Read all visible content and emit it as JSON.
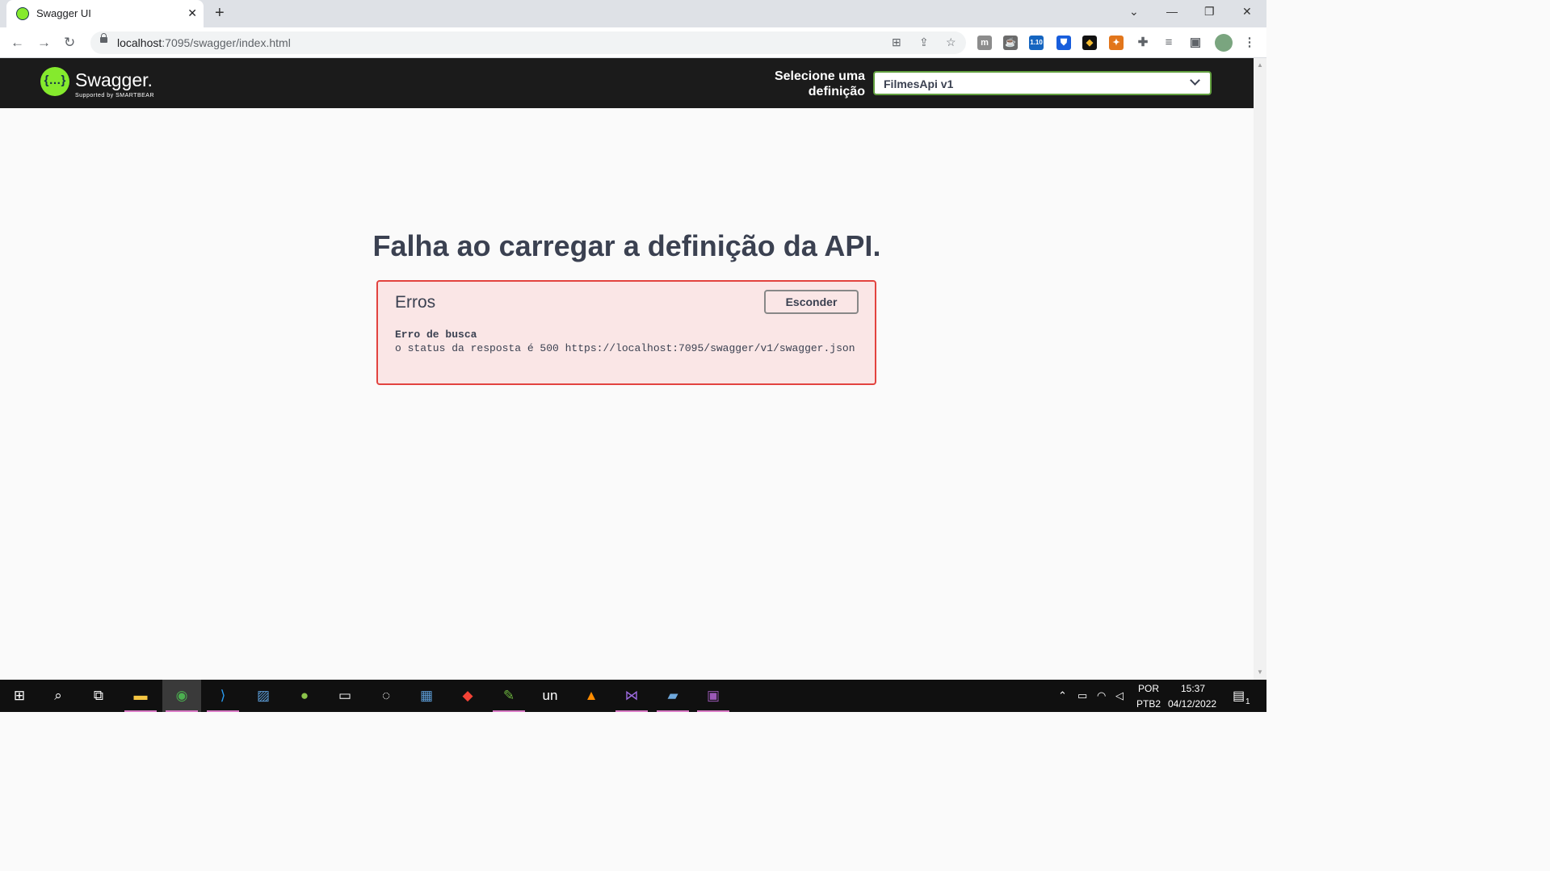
{
  "browser": {
    "tab_title": "Swagger UI",
    "tab_close": "✕",
    "new_tab": "+",
    "url_host": "localhost",
    "url_path": ":7095/swagger/index.html",
    "ext_badge": "1.10",
    "window_controls": [
      "⌄",
      "—",
      "❐",
      "✕"
    ]
  },
  "swagger": {
    "logo_glyph": "{…}",
    "logo_text": "Swagger.",
    "logo_sub": "Supported by SMARTBEAR",
    "select_label": "Selecione uma definição",
    "select_value": "FilmesApi v1",
    "accent": "#85ea2d"
  },
  "error": {
    "title": "Falha ao carregar a definição da API.",
    "heading": "Erros",
    "hide_label": "Esconder",
    "fetch_label": "Erro de busca",
    "message": "o status da resposta é 500 https://localhost:7095/swagger/v1/swagger.json",
    "border_color": "#e2433f"
  },
  "taskbar": {
    "lang_top": "POR",
    "lang_bottom": "PTB2",
    "time": "15:37",
    "date": "04/12/2022",
    "notification_count": "1",
    "un_label": "un"
  }
}
